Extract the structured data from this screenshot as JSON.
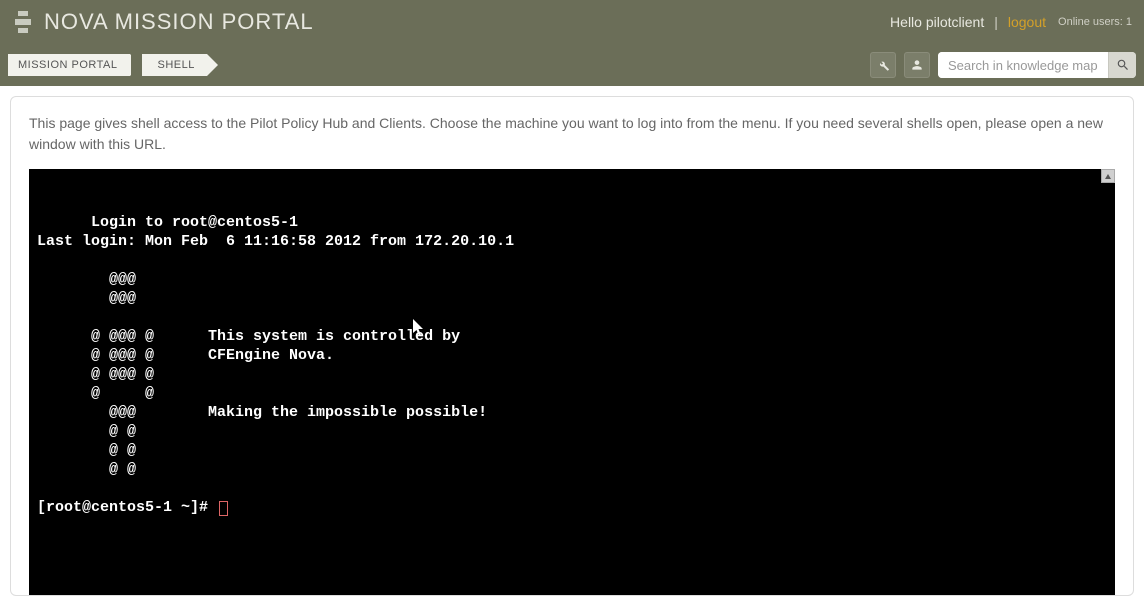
{
  "header": {
    "app_title": "NOVA MISSION PORTAL",
    "greeting": "Hello pilotclient",
    "separator": "|",
    "logout_label": "logout",
    "online_users_label": "Online users: 1"
  },
  "breadcrumb": {
    "items": [
      "MISSION PORTAL",
      "SHELL"
    ]
  },
  "toolbar": {
    "wrench_icon": "wrench-icon",
    "user_icon": "user-icon",
    "search_placeholder": "Search in knowledge map",
    "search_icon": "search-icon"
  },
  "panel": {
    "intro": "This page gives shell access to the Pilot Policy Hub and Clients. Choose the machine you want to log into from the menu. If you need several shells open, please open a new window with this URL."
  },
  "terminal": {
    "lines": [
      "Login to root@centos5-1",
      "Last login: Mon Feb  6 11:16:58 2012 from 172.20.10.1",
      "",
      "        @@@",
      "        @@@",
      "",
      "      @ @@@ @      This system is controlled by",
      "      @ @@@ @      CFEngine Nova.",
      "      @ @@@ @",
      "      @     @",
      "        @@@        Making the impossible possible!",
      "        @ @",
      "        @ @",
      "        @ @",
      ""
    ],
    "prompt": "[root@centos5-1 ~]# "
  }
}
